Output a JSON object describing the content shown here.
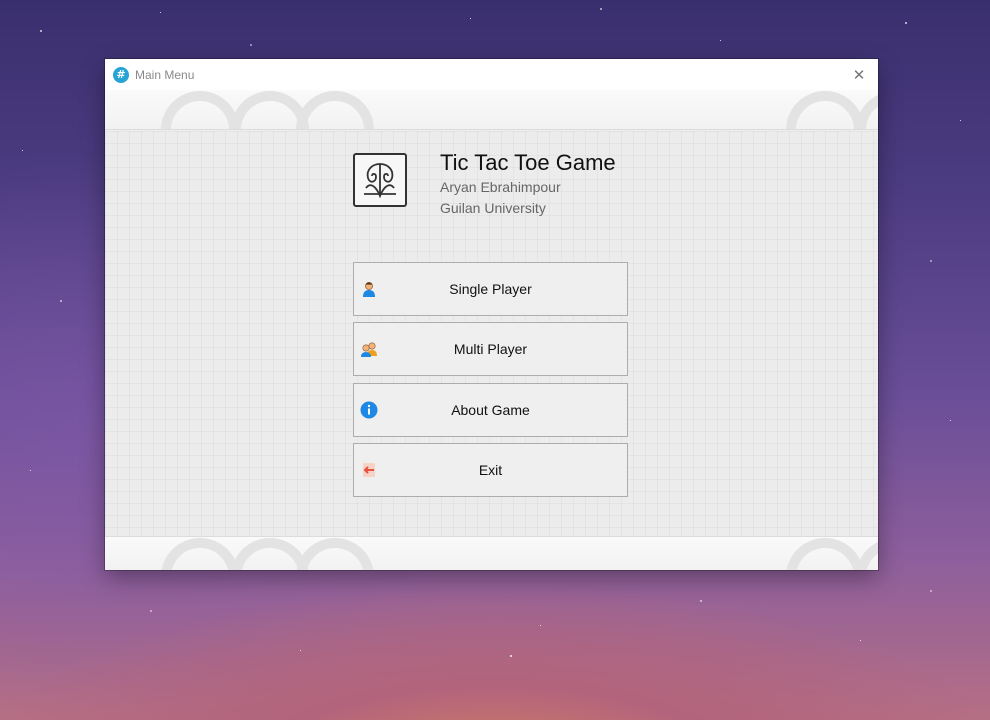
{
  "window": {
    "title": "Main Menu",
    "close_glyph": "✕",
    "app_icon": "#"
  },
  "header": {
    "app_name": "Tic Tac Toe Game",
    "author": "Aryan Ebrahimpour",
    "university": "Guilan University"
  },
  "menu": {
    "single_player": {
      "label": "Single Player",
      "icon": "person-icon"
    },
    "multi_player": {
      "label": "Multi Player",
      "icon": "people-icon"
    },
    "about": {
      "label": "About Game",
      "icon": "info-icon"
    },
    "exit": {
      "label": "Exit",
      "icon": "exit-arrow-icon"
    }
  },
  "colors": {
    "accent": "#27a3d6",
    "info_blue": "#1e88e5",
    "exit_red": "#e5533d"
  }
}
